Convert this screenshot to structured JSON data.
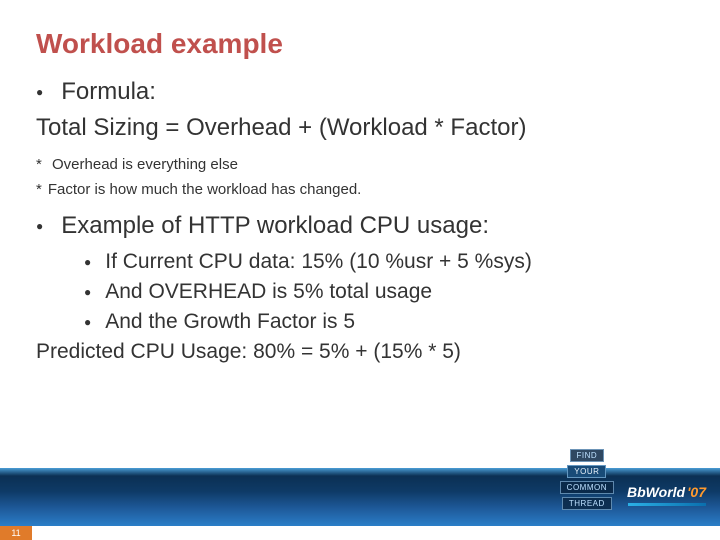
{
  "title": "Workload example",
  "bullets": {
    "formula_label": "Formula:",
    "formula_line": "Total Sizing = Overhead + (Workload * Factor)",
    "note1": "Overhead is everything else",
    "note2": "Factor is how much the workload has changed.",
    "example_label": "Example of HTTP workload CPU usage:",
    "sub": [
      "If Current CPU data: 15% (10 %usr + 5 %sys)",
      "And OVERHEAD is 5% total usage",
      "And the Growth Factor is 5"
    ],
    "predicted": "Predicted CPU Usage: 80% = 5% + (15% * 5)"
  },
  "footer": {
    "page_number": "11",
    "tag_top": "FIND",
    "tag_mid": "YOUR",
    "tag_low1": "COMMON",
    "tag_low2": "THREAD",
    "brand": "BbWorld",
    "brand_year": "'07"
  }
}
